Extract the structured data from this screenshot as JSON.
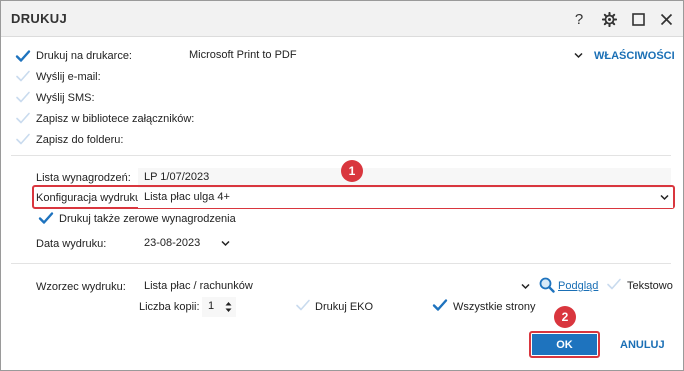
{
  "window": {
    "title": "DRUKUJ",
    "help_label": "?"
  },
  "options": {
    "print_to_printer": {
      "label": "Drukuj na drukarce:",
      "checked": true
    },
    "send_email": {
      "label": "Wyślij e-mail:",
      "checked": false
    },
    "send_sms": {
      "label": "Wyślij SMS:",
      "checked": false
    },
    "save_library": {
      "label": "Zapisz w bibliotece załączników:",
      "checked": false
    },
    "save_folder": {
      "label": "Zapisz do folderu:",
      "checked": false
    }
  },
  "printer": {
    "value": "Microsoft Print to PDF",
    "properties_label": "WŁAŚCIWOŚCI"
  },
  "payroll": {
    "label": "Lista wynagrodzeń:",
    "value": "LP 1/07/2023"
  },
  "config": {
    "label": "Konfiguracja wydruku:",
    "value": "Lista płac ulga 4+"
  },
  "zero_salaries": {
    "label": "Drukuj także zerowe wynagrodzenia",
    "checked": true
  },
  "print_date": {
    "label": "Data wydruku:",
    "value": "23-08-2023"
  },
  "template": {
    "label": "Wzorzec wydruku:",
    "value": "Lista płac / rachunków",
    "preview_label": "Podgląd",
    "text_label": "Tekstowo",
    "text_checked": false
  },
  "copies": {
    "label": "Liczba kopii:",
    "value": "1"
  },
  "eko": {
    "label": "Drukuj EKO",
    "checked": false
  },
  "all_pages": {
    "label": "Wszystkie strony",
    "checked": true
  },
  "buttons": {
    "ok_label": "OK",
    "cancel_label": "ANULUJ"
  },
  "callouts": {
    "badge1": "1",
    "badge2": "2"
  },
  "colors": {
    "accent": "#1a6fb5",
    "check": "#1e73be",
    "highlight": "#d9363e"
  }
}
